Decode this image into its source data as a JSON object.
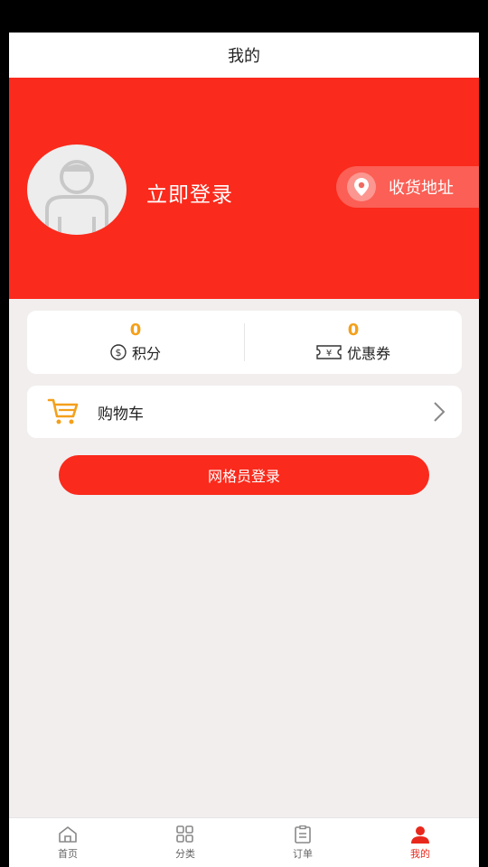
{
  "header": {
    "title": "我的"
  },
  "profile": {
    "login_label": "立即登录",
    "address_label": "收货地址"
  },
  "stats": [
    {
      "value": "0",
      "label": "积分",
      "icon": "dollar-circle-icon"
    },
    {
      "value": "0",
      "label": "优惠券",
      "icon": "coupon-icon"
    }
  ],
  "cart": {
    "label": "购物车",
    "icon": "cart-icon"
  },
  "grid_login": {
    "label": "网格员登录"
  },
  "tabs": [
    {
      "label": "首页",
      "icon": "home-icon"
    },
    {
      "label": "分类",
      "icon": "category-icon"
    },
    {
      "label": "订单",
      "icon": "order-icon"
    },
    {
      "label": "我的",
      "icon": "user-icon",
      "active": true
    }
  ],
  "colors": {
    "primary": "#fa2a1c",
    "accent": "#f4a01b",
    "tab_active": "#e8281c"
  }
}
